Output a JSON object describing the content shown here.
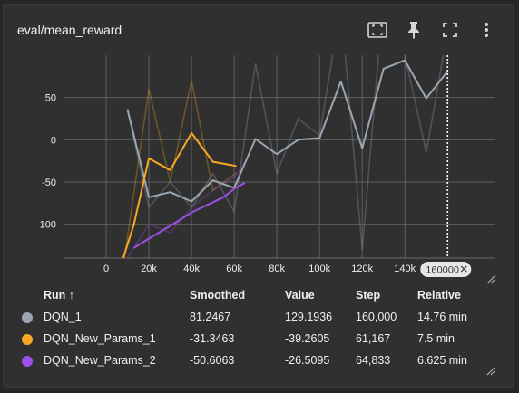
{
  "card": {
    "title": "eval/mean_reward",
    "tools": [
      "fit-domain-icon",
      "pin-icon",
      "fullscreen-icon",
      "more-vert-icon"
    ],
    "step_chip": "160000"
  },
  "chart_data": {
    "type": "line",
    "title": "eval/mean_reward",
    "xlabel": "",
    "ylabel": "",
    "xlim": [
      -20000,
      182000
    ],
    "ylim": [
      -140,
      100
    ],
    "x_ticks": [
      0,
      20000,
      40000,
      60000,
      80000,
      100000,
      120000,
      140000
    ],
    "x_tick_labels": [
      "0",
      "20k",
      "40k",
      "60k",
      "80k",
      "100k",
      "120k",
      "140k"
    ],
    "y_ticks": [
      -100,
      -50,
      0,
      50
    ],
    "y_tick_labels": [
      "-100",
      "-50",
      "0",
      "50"
    ],
    "grid": true,
    "hover_step": 160000,
    "series": [
      {
        "name": "DQN_1",
        "color": "#9aa7b2",
        "raw": [
          [
            10000,
            35
          ],
          [
            20000,
            -80
          ],
          [
            30000,
            -50
          ],
          [
            40000,
            -80
          ],
          [
            50000,
            -40
          ],
          [
            60000,
            -85
          ],
          [
            70000,
            90
          ],
          [
            80000,
            -40
          ],
          [
            90000,
            25
          ],
          [
            100000,
            5
          ],
          [
            110000,
            160
          ],
          [
            120000,
            -130
          ],
          [
            130000,
            170
          ],
          [
            140000,
            100
          ],
          [
            150000,
            -15
          ],
          [
            160000,
            129
          ]
        ],
        "smoothed": [
          [
            10000,
            36
          ],
          [
            20000,
            -68
          ],
          [
            30000,
            -62
          ],
          [
            40000,
            -73
          ],
          [
            50000,
            -48
          ],
          [
            60000,
            -57
          ],
          [
            70000,
            1
          ],
          [
            80000,
            -17
          ],
          [
            90000,
            0
          ],
          [
            100000,
            2
          ],
          [
            110000,
            69
          ],
          [
            120000,
            -10
          ],
          [
            130000,
            84
          ],
          [
            140000,
            94
          ],
          [
            150000,
            49
          ],
          [
            160000,
            81
          ]
        ]
      },
      {
        "name": "DQN_New_Params_1",
        "color": "#f7a822",
        "raw": [
          [
            8000,
            -150
          ],
          [
            20000,
            60
          ],
          [
            30000,
            -50
          ],
          [
            40000,
            70
          ],
          [
            50000,
            -60
          ],
          [
            61000,
            -39
          ]
        ],
        "smoothed": [
          [
            8000,
            -140
          ],
          [
            13000,
            -100
          ],
          [
            20000,
            -22
          ],
          [
            30000,
            -36
          ],
          [
            40000,
            8
          ],
          [
            50000,
            -26
          ],
          [
            61000,
            -31
          ]
        ]
      },
      {
        "name": "DQN_New_Params_2",
        "color": "#9d50e8",
        "raw": [
          [
            10000,
            -140
          ],
          [
            20000,
            -100
          ],
          [
            30000,
            -110
          ],
          [
            40000,
            -80
          ],
          [
            50000,
            -60
          ],
          [
            60000,
            -45
          ],
          [
            65000,
            -27
          ]
        ],
        "smoothed": [
          [
            13000,
            -128
          ],
          [
            20000,
            -117
          ],
          [
            30000,
            -102
          ],
          [
            40000,
            -86
          ],
          [
            50000,
            -74
          ],
          [
            55000,
            -68
          ],
          [
            60000,
            -58
          ],
          [
            65000,
            -51
          ]
        ]
      }
    ]
  },
  "table": {
    "headers": {
      "run": "Run ↑",
      "smoothed": "Smoothed",
      "value": "Value",
      "step": "Step",
      "relative": "Relative"
    },
    "rows": [
      {
        "run": "DQN_1",
        "color": "#9aa7b2",
        "smoothed": "81.2467",
        "value": "129.1936",
        "step": "160,000",
        "relative": "14.76 min"
      },
      {
        "run": "DQN_New_Params_1",
        "color": "#f7a822",
        "smoothed": "-31.3463",
        "value": "-39.2605",
        "step": "61,167",
        "relative": "7.5 min"
      },
      {
        "run": "DQN_New_Params_2",
        "color": "#9d50e8",
        "smoothed": "-50.6063",
        "value": "-26.5095",
        "step": "64,833",
        "relative": "6.625 min"
      }
    ]
  }
}
